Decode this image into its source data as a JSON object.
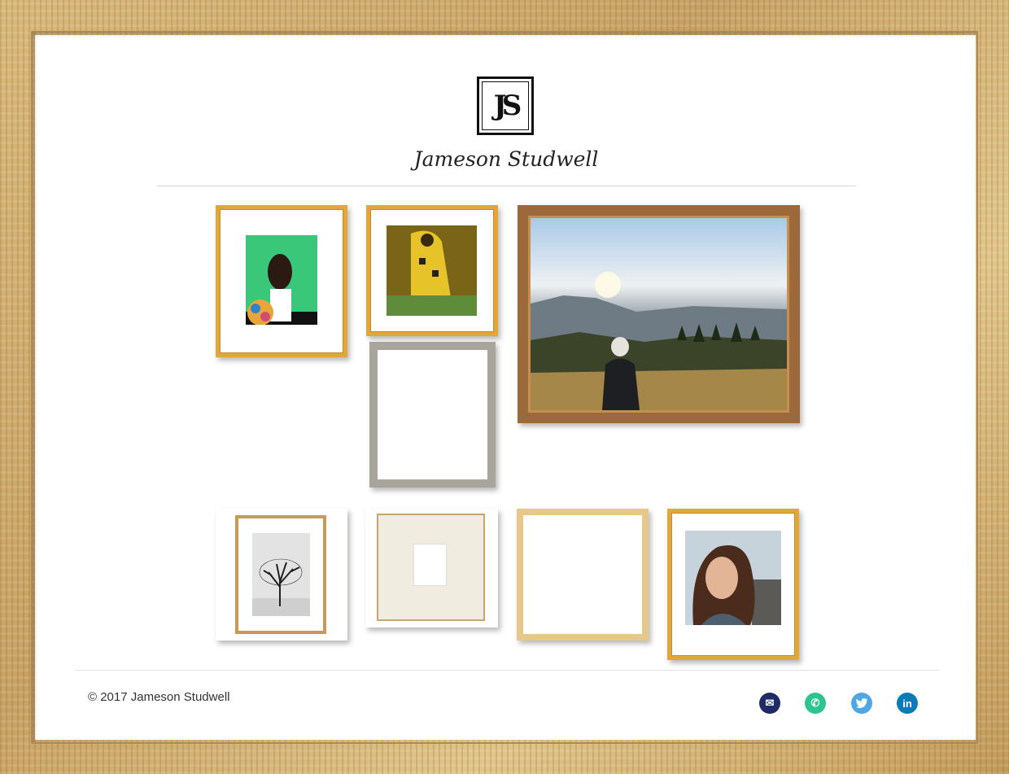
{
  "site": {
    "logo_text": "JS",
    "name": "Jameson Studwell"
  },
  "gallery": {
    "frames": [
      {
        "id": "frame-1",
        "subject": "woman with backpack on green background"
      },
      {
        "id": "frame-2",
        "subject": "The Kiss painting"
      },
      {
        "id": "frame-3",
        "subject": "empty white frame"
      },
      {
        "id": "frame-4",
        "subject": "hiker at mountain sunrise"
      },
      {
        "id": "frame-5",
        "subject": "tree in fog"
      },
      {
        "id": "frame-6",
        "subject": "cream mat frame"
      },
      {
        "id": "frame-7",
        "subject": "empty gold frame"
      },
      {
        "id": "frame-8",
        "subject": "smiling woman portrait"
      }
    ]
  },
  "footer": {
    "copyright": "© 2017 Jameson Studwell",
    "social": [
      {
        "name": "email-icon",
        "color": "#1f2b66"
      },
      {
        "name": "phone-icon",
        "color": "#2cc48f"
      },
      {
        "name": "twitter-icon",
        "color": "#4fa6e6"
      },
      {
        "name": "linkedin-icon",
        "color": "#0d7ab8"
      }
    ]
  }
}
